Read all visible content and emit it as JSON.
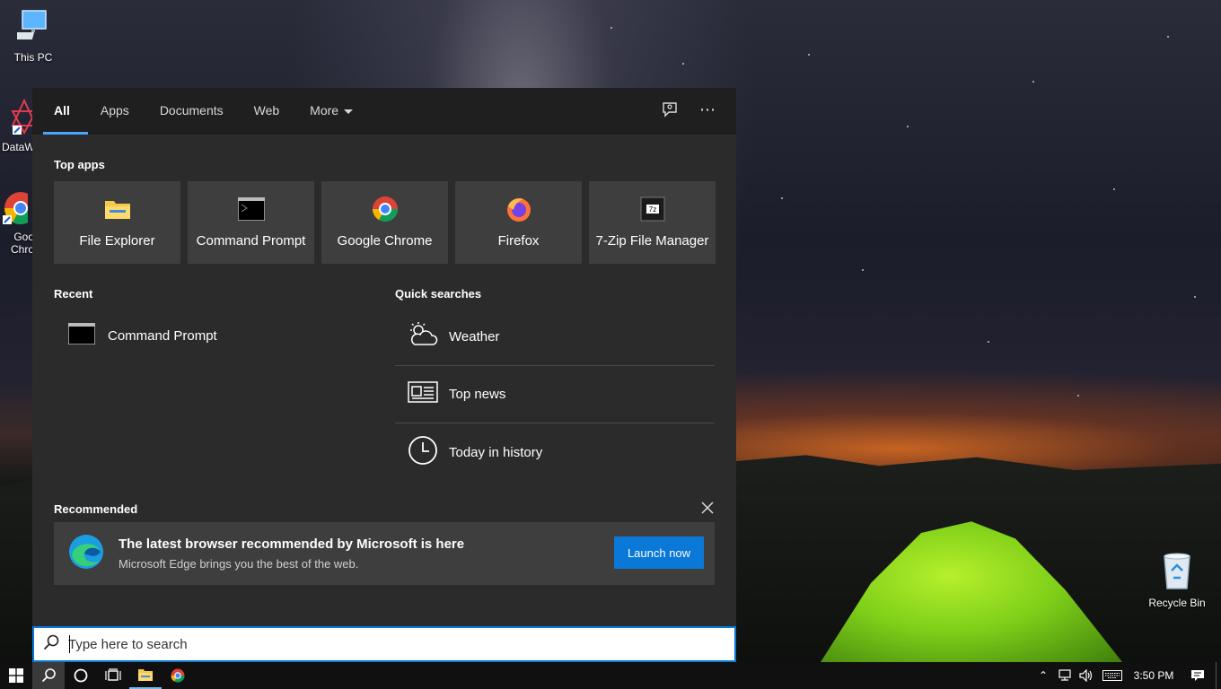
{
  "desktop": {
    "icons": [
      {
        "label": "This PC"
      },
      {
        "label": "DataW"
      },
      {
        "label": "Goo Chro"
      },
      {
        "label": "Recycle Bin"
      }
    ]
  },
  "search_panel": {
    "tabs": [
      {
        "label": "All",
        "active": true
      },
      {
        "label": "Apps"
      },
      {
        "label": "Documents"
      },
      {
        "label": "Web"
      },
      {
        "label": "More"
      }
    ],
    "top_apps": {
      "title": "Top apps",
      "items": [
        {
          "label": "File Explorer",
          "icon": "folder-icon"
        },
        {
          "label": "Command Prompt",
          "icon": "cmd-icon"
        },
        {
          "label": "Google Chrome",
          "icon": "chrome-icon"
        },
        {
          "label": "Firefox",
          "icon": "firefox-icon"
        },
        {
          "label": "7-Zip File Manager",
          "icon": "7zip-icon"
        }
      ]
    },
    "recent": {
      "title": "Recent",
      "items": [
        {
          "label": "Command Prompt",
          "icon": "cmd-icon"
        }
      ]
    },
    "quick_searches": {
      "title": "Quick searches",
      "items": [
        {
          "label": "Weather",
          "icon": "weather-icon"
        },
        {
          "label": "Top news",
          "icon": "news-icon"
        },
        {
          "label": "Today in history",
          "icon": "clock-icon"
        }
      ]
    },
    "recommended": {
      "title": "Recommended",
      "headline": "The latest browser recommended by Microsoft is here",
      "subtext": "Microsoft Edge brings you the best of the web.",
      "button": "Launch now"
    }
  },
  "search_box": {
    "placeholder": "Type here to search",
    "value": ""
  },
  "taskbar": {
    "time": "3:50 PM"
  },
  "colors": {
    "accent": "#0a78d7",
    "tab_underline": "#4aa3ff",
    "panel_bg": "#2b2b2b",
    "tile_bg": "#3e3e3e"
  }
}
